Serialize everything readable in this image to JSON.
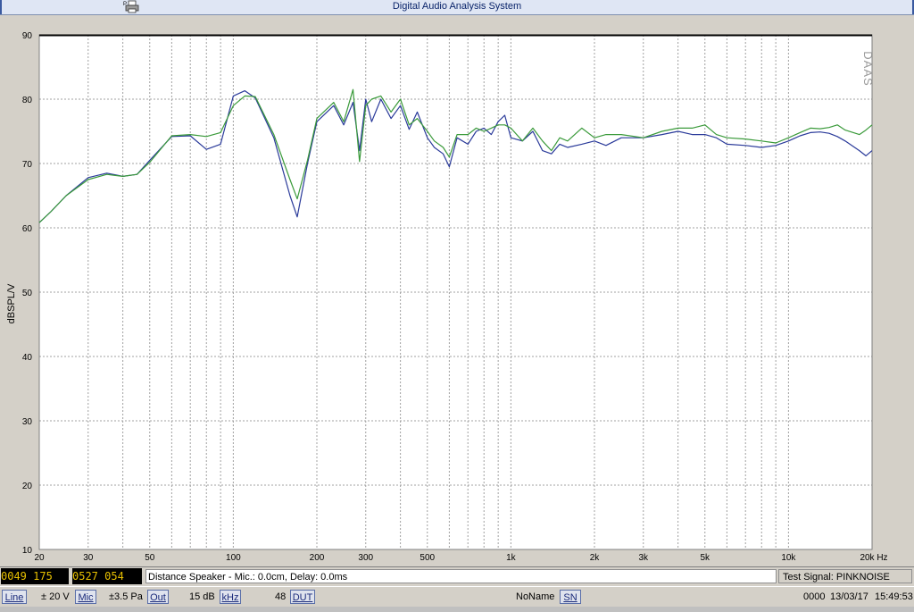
{
  "window": {
    "title": "Digital Audio Analysis System"
  },
  "icons": {
    "print": "printer-icon"
  },
  "chart_data": {
    "type": "line",
    "ylabel": "dBSPL/V",
    "watermark": "DAAS",
    "x_scale": "log",
    "xlim": [
      20,
      20000
    ],
    "ylim": [
      10,
      90
    ],
    "grid": true,
    "y_ticks": [
      10,
      20,
      30,
      40,
      50,
      60,
      70,
      80,
      90
    ],
    "x_tick_labels": [
      {
        "v": 20,
        "t": "20"
      },
      {
        "v": 30,
        "t": "30"
      },
      {
        "v": 50,
        "t": "50"
      },
      {
        "v": 100,
        "t": "100"
      },
      {
        "v": 200,
        "t": "200"
      },
      {
        "v": 300,
        "t": "300"
      },
      {
        "v": 500,
        "t": "500"
      },
      {
        "v": 1000,
        "t": "1k"
      },
      {
        "v": 2000,
        "t": "2k"
      },
      {
        "v": 3000,
        "t": "3k"
      },
      {
        "v": 5000,
        "t": "5k"
      },
      {
        "v": 10000,
        "t": "10k"
      },
      {
        "v": 20000,
        "t": "20k Hz"
      }
    ],
    "series": [
      {
        "color": "#2a3a9a",
        "points": [
          [
            20,
            60.8
          ],
          [
            22,
            62.5
          ],
          [
            25,
            65
          ],
          [
            30,
            67.8
          ],
          [
            35,
            68.5
          ],
          [
            40,
            68
          ],
          [
            45,
            68.3
          ],
          [
            50,
            70.5
          ],
          [
            60,
            74.2
          ],
          [
            70,
            74.3
          ],
          [
            80,
            72.2
          ],
          [
            90,
            73
          ],
          [
            100,
            80.5
          ],
          [
            110,
            81.3
          ],
          [
            120,
            80.2
          ],
          [
            140,
            74
          ],
          [
            160,
            65
          ],
          [
            170,
            61.7
          ],
          [
            185,
            70
          ],
          [
            200,
            76.5
          ],
          [
            230,
            79
          ],
          [
            250,
            76
          ],
          [
            270,
            79.5
          ],
          [
            285,
            72
          ],
          [
            300,
            80
          ],
          [
            315,
            76.5
          ],
          [
            340,
            80
          ],
          [
            370,
            77
          ],
          [
            400,
            79
          ],
          [
            430,
            75.3
          ],
          [
            460,
            78
          ],
          [
            500,
            74
          ],
          [
            530,
            72.5
          ],
          [
            570,
            71.5
          ],
          [
            600,
            69.5
          ],
          [
            640,
            74
          ],
          [
            700,
            73
          ],
          [
            750,
            75
          ],
          [
            800,
            75.5
          ],
          [
            850,
            74.5
          ],
          [
            900,
            76.5
          ],
          [
            950,
            77.5
          ],
          [
            1000,
            74
          ],
          [
            1100,
            73.5
          ],
          [
            1200,
            75
          ],
          [
            1300,
            72
          ],
          [
            1400,
            71.5
          ],
          [
            1500,
            73
          ],
          [
            1600,
            72.5
          ],
          [
            1800,
            73
          ],
          [
            2000,
            73.5
          ],
          [
            2200,
            72.8
          ],
          [
            2500,
            74
          ],
          [
            3000,
            74
          ],
          [
            3500,
            74.5
          ],
          [
            4000,
            75
          ],
          [
            4500,
            74.5
          ],
          [
            5000,
            74.5
          ],
          [
            5500,
            74
          ],
          [
            6000,
            73
          ],
          [
            7000,
            72.8
          ],
          [
            8000,
            72.5
          ],
          [
            9000,
            72.8
          ],
          [
            10000,
            73.5
          ],
          [
            11000,
            74.3
          ],
          [
            12000,
            74.8
          ],
          [
            13000,
            74.9
          ],
          [
            14000,
            74.7
          ],
          [
            15000,
            74.2
          ],
          [
            16000,
            73.5
          ],
          [
            18000,
            72
          ],
          [
            19000,
            71.2
          ],
          [
            20000,
            72
          ]
        ]
      },
      {
        "color": "#3a9a3a",
        "points": [
          [
            20,
            60.8
          ],
          [
            22,
            62.5
          ],
          [
            25,
            65
          ],
          [
            30,
            67.5
          ],
          [
            35,
            68.3
          ],
          [
            40,
            68
          ],
          [
            45,
            68.3
          ],
          [
            50,
            70.2
          ],
          [
            60,
            74.3
          ],
          [
            70,
            74.5
          ],
          [
            80,
            74.2
          ],
          [
            90,
            74.8
          ],
          [
            100,
            79
          ],
          [
            110,
            80.5
          ],
          [
            120,
            80.4
          ],
          [
            140,
            74.5
          ],
          [
            160,
            67.5
          ],
          [
            170,
            64.5
          ],
          [
            185,
            70.5
          ],
          [
            200,
            77
          ],
          [
            230,
            79.5
          ],
          [
            250,
            76.5
          ],
          [
            270,
            81.5
          ],
          [
            285,
            70.3
          ],
          [
            300,
            79
          ],
          [
            315,
            80
          ],
          [
            340,
            80.5
          ],
          [
            370,
            78
          ],
          [
            400,
            80
          ],
          [
            430,
            76
          ],
          [
            460,
            77
          ],
          [
            500,
            75
          ],
          [
            530,
            73.5
          ],
          [
            570,
            72.5
          ],
          [
            600,
            71
          ],
          [
            640,
            74.5
          ],
          [
            700,
            74.5
          ],
          [
            750,
            75.5
          ],
          [
            800,
            75
          ],
          [
            850,
            75.5
          ],
          [
            900,
            76
          ],
          [
            950,
            76
          ],
          [
            1000,
            75.5
          ],
          [
            1100,
            73.5
          ],
          [
            1200,
            75.5
          ],
          [
            1300,
            73.5
          ],
          [
            1400,
            72
          ],
          [
            1500,
            74
          ],
          [
            1600,
            73.5
          ],
          [
            1800,
            75.5
          ],
          [
            2000,
            74
          ],
          [
            2200,
            74.5
          ],
          [
            2500,
            74.5
          ],
          [
            3000,
            74
          ],
          [
            3500,
            75
          ],
          [
            4000,
            75.5
          ],
          [
            4500,
            75.5
          ],
          [
            5000,
            76
          ],
          [
            5500,
            74.5
          ],
          [
            6000,
            74
          ],
          [
            7000,
            73.8
          ],
          [
            8000,
            73.5
          ],
          [
            9000,
            73.2
          ],
          [
            10000,
            74
          ],
          [
            11000,
            74.8
          ],
          [
            12000,
            75.5
          ],
          [
            13000,
            75.4
          ],
          [
            14000,
            75.6
          ],
          [
            15000,
            76
          ],
          [
            16000,
            75.2
          ],
          [
            18000,
            74.5
          ],
          [
            19000,
            75.2
          ],
          [
            20000,
            76
          ]
        ]
      }
    ]
  },
  "info": {
    "lcd_left": "0049 175",
    "lcd_mid": "0527 054",
    "distance": "Distance Speaker - Mic.: 0.0cm, Delay: 0.0ms",
    "test_signal": "Test Signal: PINKNOISE"
  },
  "status": {
    "line": "Line",
    "voltage": "± 20 V",
    "mic": "Mic",
    "pressure": "±3.5 Pa",
    "out": "Out",
    "gain": "15 dB",
    "khz": "kHz",
    "rate": "48",
    "dut": "DUT",
    "noname": "NoName",
    "sn": "SN",
    "counter": "0000",
    "date": "13/03/17",
    "time": "15:49:53"
  }
}
